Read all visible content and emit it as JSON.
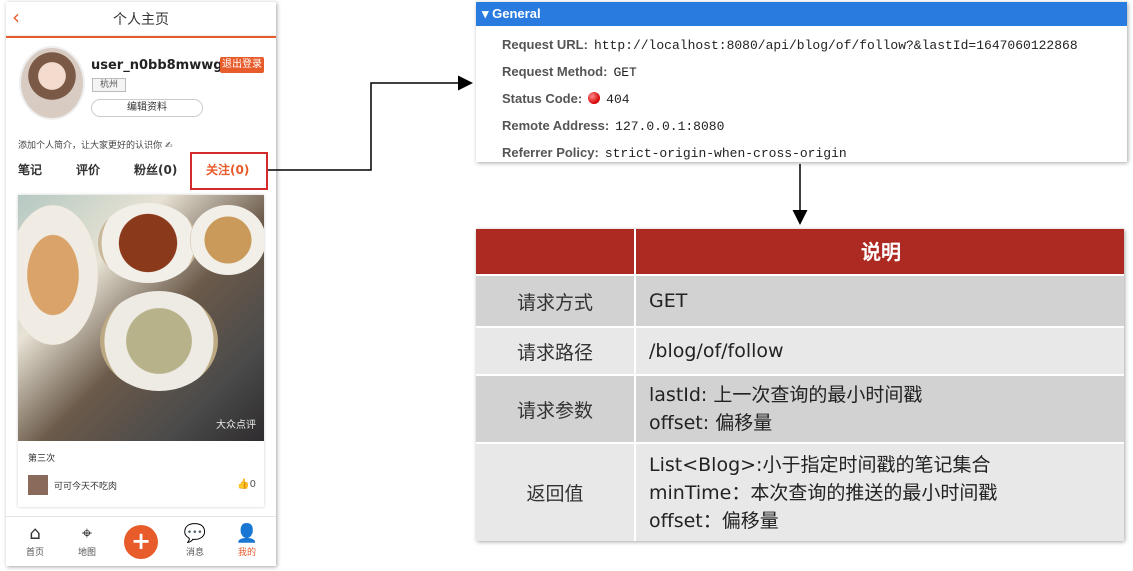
{
  "phone": {
    "title": "个人主页",
    "username": "user_n0bb8mwwg4",
    "logout_label": "退出登录",
    "city": "杭州",
    "edit_label": "编辑资料",
    "bio": "添加个人简介，让大家更好的认识你 ✍",
    "tabs": [
      "笔记",
      "评价",
      "粉丝(0)",
      "关注(0)"
    ],
    "card": {
      "watermark": "大众点评",
      "title": "第三次",
      "author": "可可今天不吃肉",
      "likes": "0"
    },
    "nav": [
      "首页",
      "地图",
      "消息",
      "我的"
    ],
    "accent": "#e85b2a"
  },
  "general": {
    "header": "General",
    "rows": [
      {
        "key": "Request URL:",
        "value": "http://localhost:8080/api/blog/of/follow?&lastId=1647060122868"
      },
      {
        "key": "Request Method:",
        "value": "GET"
      },
      {
        "key": "Status Code:",
        "value": "404"
      },
      {
        "key": "Remote Address:",
        "value": "127.0.0.1:8080"
      },
      {
        "key": "Referrer Policy:",
        "value": "strict-origin-when-cross-origin"
      }
    ],
    "accent": "#2a7be0"
  },
  "table": {
    "header": "说明",
    "rows": [
      {
        "label": "请求方式",
        "lines": [
          "GET"
        ]
      },
      {
        "label": "请求路径",
        "lines": [
          "/blog/of/follow"
        ]
      },
      {
        "label": "请求参数",
        "lines": [
          "lastId: 上一次查询的最小时间戳",
          "offset: 偏移量"
        ]
      },
      {
        "label": "返回值",
        "lines": [
          "List<Blog>:小于指定时间戳的笔记集合",
          "minTime：本次查询的推送的最小时间戳",
          "offset：偏移量"
        ]
      }
    ],
    "header_color": "#ad2a22"
  }
}
